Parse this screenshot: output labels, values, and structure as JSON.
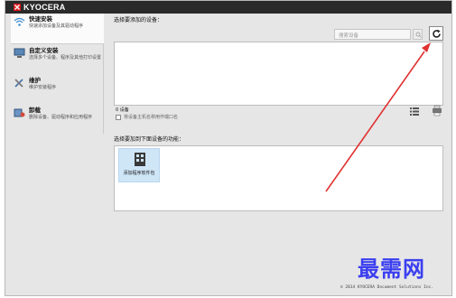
{
  "brand": {
    "name": "KYOCERA"
  },
  "sidebar": {
    "items": [
      {
        "label": "快速安装",
        "desc": "快速添加设备及其驱动程序",
        "icon": "wifi-icon"
      },
      {
        "label": "自定义安装",
        "desc": "选择多个设备、程序及其他打印设置",
        "icon": "computer-icon"
      },
      {
        "label": "维护",
        "desc": "维护安装程序",
        "icon": "tools-icon"
      },
      {
        "label": "卸载",
        "desc": "删除设备、驱动程序和应用程序",
        "icon": "uninstall-icon"
      }
    ]
  },
  "devices": {
    "heading": "选择要添加的设备：",
    "search_placeholder": "搜索设备",
    "count_text": "0 设备",
    "checkbox_label": "将设备主机名称用作端口名"
  },
  "functions": {
    "heading": "选择要加到下面设备的功能：",
    "items": [
      {
        "label": "添加程序软件包",
        "icon": "package-icon"
      }
    ]
  },
  "footer": {
    "copyright": "© 2014 KYOCERA Document Solutions Inc."
  },
  "watermark": {
    "text": "最需网"
  },
  "colors": {
    "titlebar": "#2a2a2a",
    "brand_red": "#d7161b",
    "annotation_arrow": "#e03232",
    "watermark": "#3b3ff0",
    "tile": "#cfe6f7"
  }
}
